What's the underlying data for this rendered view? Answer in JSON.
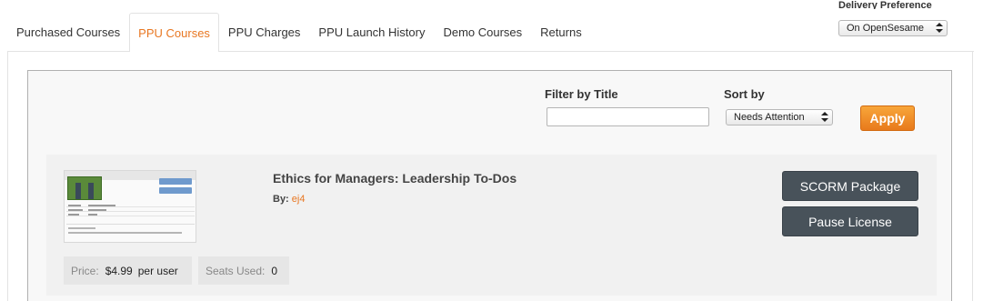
{
  "tabs": [
    {
      "label": "Purchased Courses",
      "active": false
    },
    {
      "label": "PPU Courses",
      "active": true
    },
    {
      "label": "PPU Charges",
      "active": false
    },
    {
      "label": "PPU Launch History",
      "active": false
    },
    {
      "label": "Demo Courses",
      "active": false
    },
    {
      "label": "Returns",
      "active": false
    }
  ],
  "delivery": {
    "label": "Delivery Preference",
    "selected": "On OpenSesame"
  },
  "filter": {
    "filter_label": "Filter by Title",
    "filter_value": "",
    "sort_label": "Sort by",
    "sort_selected": "Needs Attention",
    "apply_label": "Apply"
  },
  "course": {
    "title": "Ethics for Managers: Leadership To-Dos",
    "by_label": "By:",
    "author": "ej4",
    "scorm_label": "SCORM Package",
    "pause_label": "Pause License",
    "price_label": "Price:",
    "price_value": "$4.99",
    "price_unit": "per user",
    "seats_label": "Seats Used:",
    "seats_value": "0"
  },
  "colors": {
    "accent": "#e87722",
    "dark_button": "#48525a"
  }
}
